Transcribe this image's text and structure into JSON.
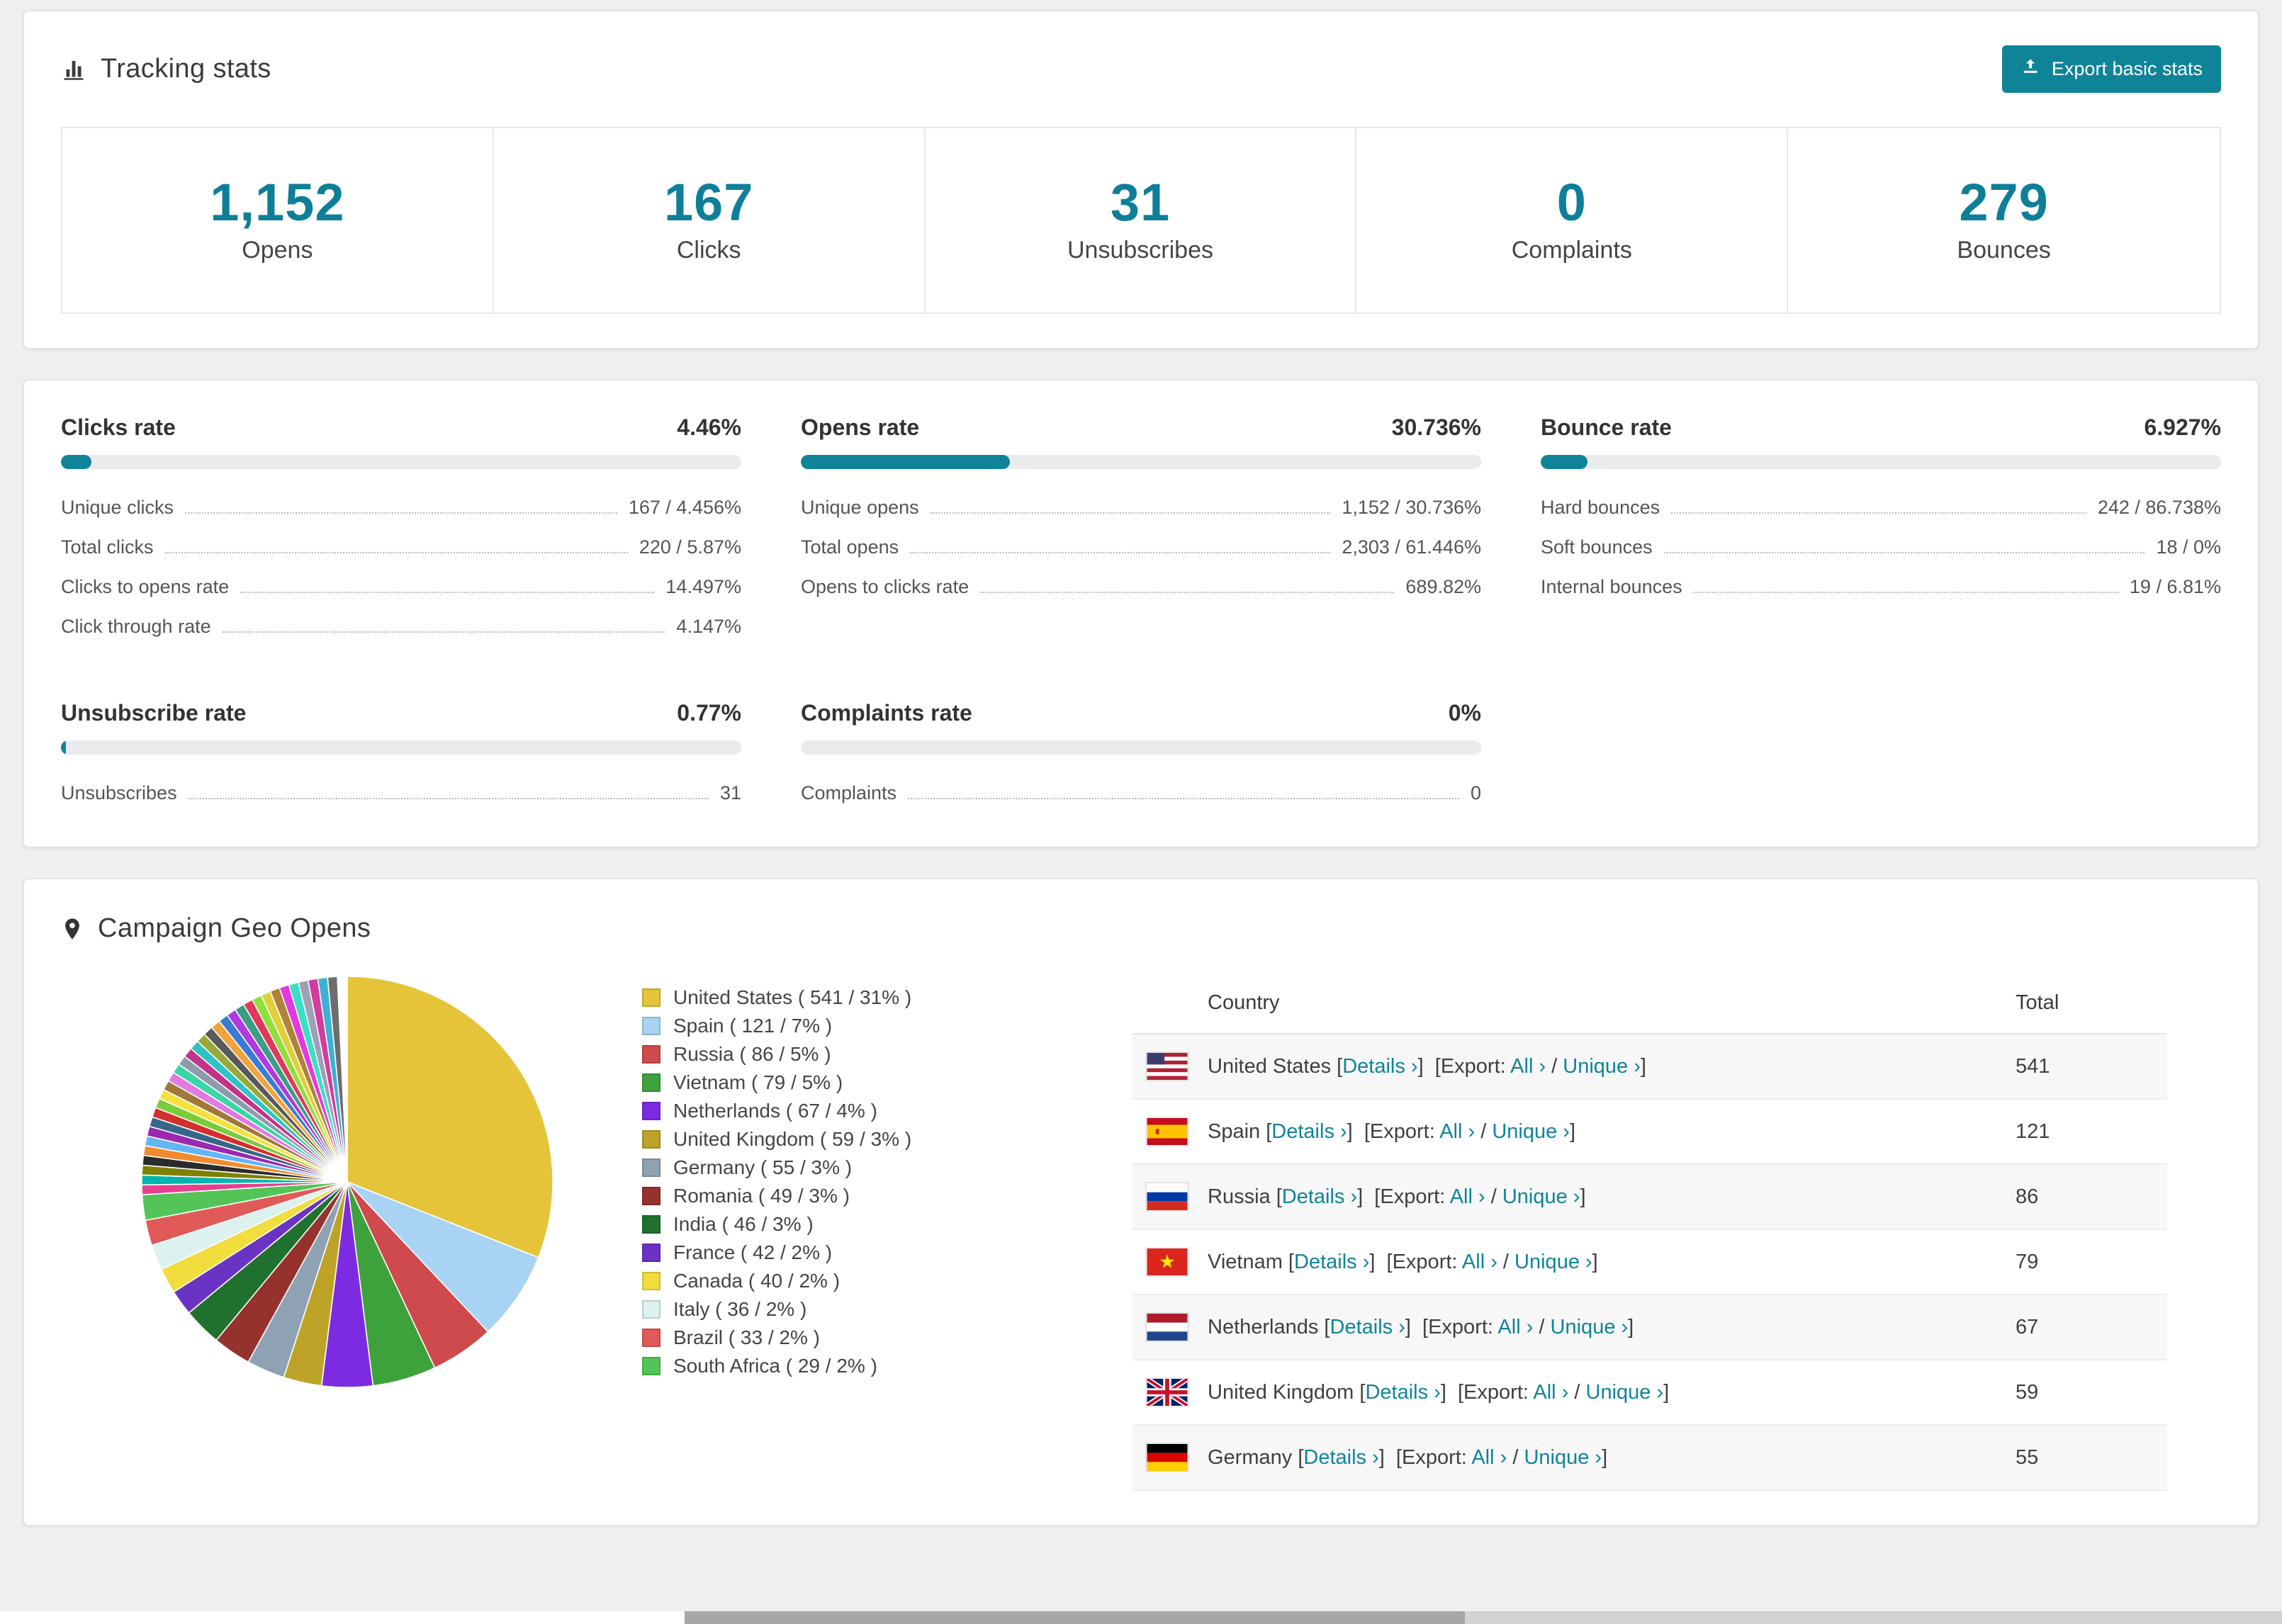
{
  "colors": {
    "accent": "#0f8499",
    "stat_number": "#0e7f99",
    "link": "#0f8499",
    "bar_fill": "#0f8499",
    "bar_track": "#e9ebed"
  },
  "tracking": {
    "title": "Tracking stats",
    "export_button": "Export basic stats",
    "stats": [
      {
        "value": "1,152",
        "label": "Opens"
      },
      {
        "value": "167",
        "label": "Clicks"
      },
      {
        "value": "31",
        "label": "Unsubscribes"
      },
      {
        "value": "0",
        "label": "Complaints"
      },
      {
        "value": "279",
        "label": "Bounces"
      }
    ]
  },
  "rates": [
    {
      "title": "Clicks rate",
      "percent_label": "4.46%",
      "percent": 4.46,
      "rows": [
        {
          "label": "Unique clicks",
          "value": "167 / 4.456%"
        },
        {
          "label": "Total clicks",
          "value": "220 / 5.87%"
        },
        {
          "label": "Clicks to opens rate",
          "value": "14.497%"
        },
        {
          "label": "Click through rate",
          "value": "4.147%"
        }
      ]
    },
    {
      "title": "Opens rate",
      "percent_label": "30.736%",
      "percent": 30.736,
      "rows": [
        {
          "label": "Unique opens",
          "value": "1,152 / 30.736%"
        },
        {
          "label": "Total opens",
          "value": "2,303 / 61.446%"
        },
        {
          "label": "Opens to clicks rate",
          "value": "689.82%"
        }
      ]
    },
    {
      "title": "Bounce rate",
      "percent_label": "6.927%",
      "percent": 6.927,
      "rows": [
        {
          "label": "Hard bounces",
          "value": "242 / 86.738%"
        },
        {
          "label": "Soft bounces",
          "value": "18 / 0%"
        },
        {
          "label": "Internal bounces",
          "value": "19 / 6.81%"
        }
      ]
    },
    {
      "title": "Unsubscribe rate",
      "percent_label": "0.77%",
      "percent": 0.77,
      "rows": [
        {
          "label": "Unsubscribes",
          "value": "31"
        }
      ]
    },
    {
      "title": "Complaints rate",
      "percent_label": "0%",
      "percent": 0,
      "rows": [
        {
          "label": "Complaints",
          "value": "0"
        }
      ]
    }
  ],
  "geo": {
    "title": "Campaign Geo Opens",
    "table": {
      "country_header": "Country",
      "total_header": "Total",
      "details_label": "Details ›",
      "export_prefix": "Export:",
      "all_label": "All ›",
      "unique_label": "Unique ›",
      "rows": [
        {
          "country": "United States",
          "flag": "us",
          "total": "541"
        },
        {
          "country": "Spain",
          "flag": "es",
          "total": "121"
        },
        {
          "country": "Russia",
          "flag": "ru",
          "total": "86"
        },
        {
          "country": "Vietnam",
          "flag": "vn",
          "total": "79"
        },
        {
          "country": "Netherlands",
          "flag": "nl",
          "total": "67"
        },
        {
          "country": "United Kingdom",
          "flag": "gb",
          "total": "59"
        },
        {
          "country": "Germany",
          "flag": "de",
          "total": "55"
        }
      ]
    }
  },
  "chart_data": {
    "type": "pie",
    "title": "Campaign Geo Opens",
    "legend_position": "right",
    "slices": [
      {
        "label": "United States",
        "value": 541,
        "percent": 31,
        "color": "#e5c43a"
      },
      {
        "label": "Spain",
        "value": 121,
        "percent": 7,
        "color": "#a9d3f2"
      },
      {
        "label": "Russia",
        "value": 86,
        "percent": 5,
        "color": "#cf4a4c"
      },
      {
        "label": "Vietnam",
        "value": 79,
        "percent": 5,
        "color": "#3da23c"
      },
      {
        "label": "Netherlands",
        "value": 67,
        "percent": 4,
        "color": "#7c2be0"
      },
      {
        "label": "United Kingdom",
        "value": 59,
        "percent": 3,
        "color": "#bda429"
      },
      {
        "label": "Germany",
        "value": 55,
        "percent": 3,
        "color": "#8fa2b4"
      },
      {
        "label": "Romania",
        "value": 49,
        "percent": 3,
        "color": "#96322e"
      },
      {
        "label": "India",
        "value": 46,
        "percent": 3,
        "color": "#20712f"
      },
      {
        "label": "France",
        "value": 42,
        "percent": 2,
        "color": "#6a33c4"
      },
      {
        "label": "Canada",
        "value": 40,
        "percent": 2,
        "color": "#f2dd3e"
      },
      {
        "label": "Italy",
        "value": 36,
        "percent": 2,
        "color": "#dbf2ee"
      },
      {
        "label": "Brazil",
        "value": 33,
        "percent": 2,
        "color": "#e05a58"
      },
      {
        "label": "South Africa",
        "value": 29,
        "percent": 2,
        "color": "#52c556"
      }
    ],
    "others_percent": 26
  }
}
